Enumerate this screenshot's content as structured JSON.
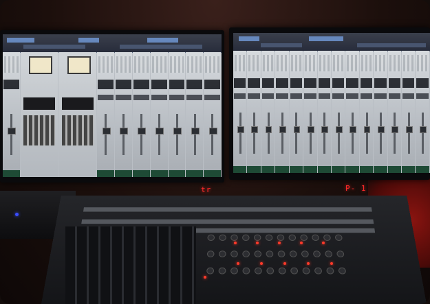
{
  "scene": {
    "description_tags": [
      "dual-monitor",
      "daw-mixer",
      "control-surface"
    ],
    "colors": {
      "wall": "#2a1613",
      "led_red": "#ff3a2a",
      "led_blue": "#3a4dff",
      "screen_ui": "#b9bec4"
    }
  },
  "control_surface": {
    "display_left": "tr",
    "display_right": "P-  1"
  }
}
